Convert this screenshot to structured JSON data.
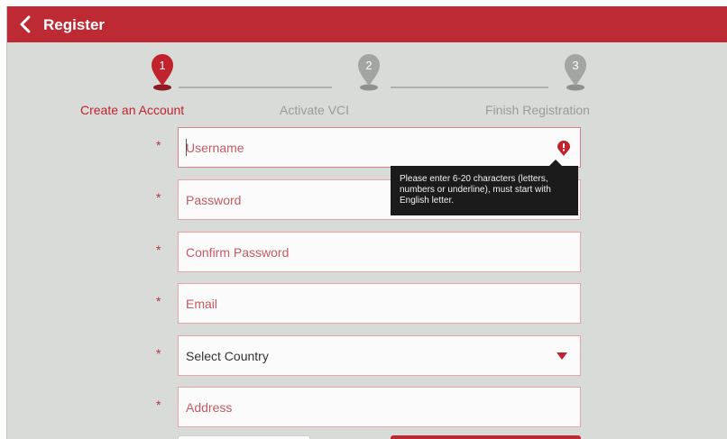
{
  "header": {
    "title": "Register"
  },
  "stepper": {
    "steps": [
      {
        "number": "1",
        "label": "Create an Account",
        "active": true
      },
      {
        "number": "2",
        "label": "Activate VCI",
        "active": false
      },
      {
        "number": "3",
        "label": "Finish Registration",
        "active": false
      }
    ]
  },
  "form": {
    "required_mark": "*",
    "fields": [
      {
        "placeholder": "Username",
        "value": ""
      },
      {
        "placeholder": "Password",
        "value": ""
      },
      {
        "placeholder": "Confirm Password",
        "value": ""
      },
      {
        "placeholder": "Email",
        "value": ""
      },
      {
        "selected": "Select Country"
      },
      {
        "placeholder": "Address",
        "value": ""
      }
    ],
    "username_error_tooltip": "Please enter 6-20 characters (letters, numbers or underline), must start with English letter."
  },
  "colors": {
    "brand": "#bd2a34",
    "background": "#d8dbd7",
    "inactive": "#9a9c99"
  }
}
